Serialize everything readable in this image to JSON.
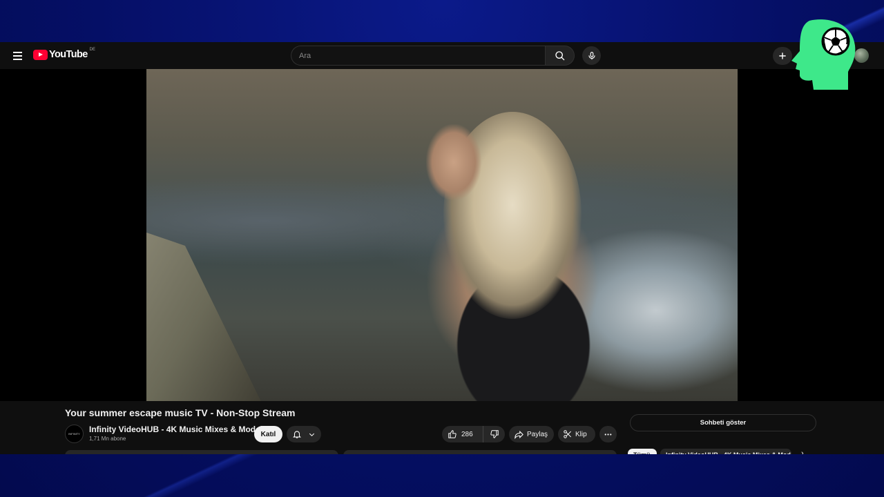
{
  "masthead": {
    "logo_text": "YouTube",
    "country_code": "DE",
    "search_placeholder": "Ara"
  },
  "video": {
    "title": "Your summer escape music TV - Non-Stop Stream"
  },
  "channel": {
    "name": "Infinity VideoHUB - 4K Music Mixes & Models",
    "subscribers": "1,71 Mn abone",
    "avatar_text": "INFINITY"
  },
  "actions": {
    "join_label": "Katıl",
    "like_count": "286",
    "share_label": "Paylaş",
    "clip_label": "Klip"
  },
  "sidebar": {
    "chat_button_label": "Sohbeti göster",
    "chips": [
      "Tümü",
      "Infinity VideoHUB - 4K Music Mixes & Mod"
    ]
  },
  "colors": {
    "brand_red": "#ff0033",
    "background": "#0f0f0f",
    "frame_blue": "#05106b",
    "badge_green": "#3ee88a"
  }
}
